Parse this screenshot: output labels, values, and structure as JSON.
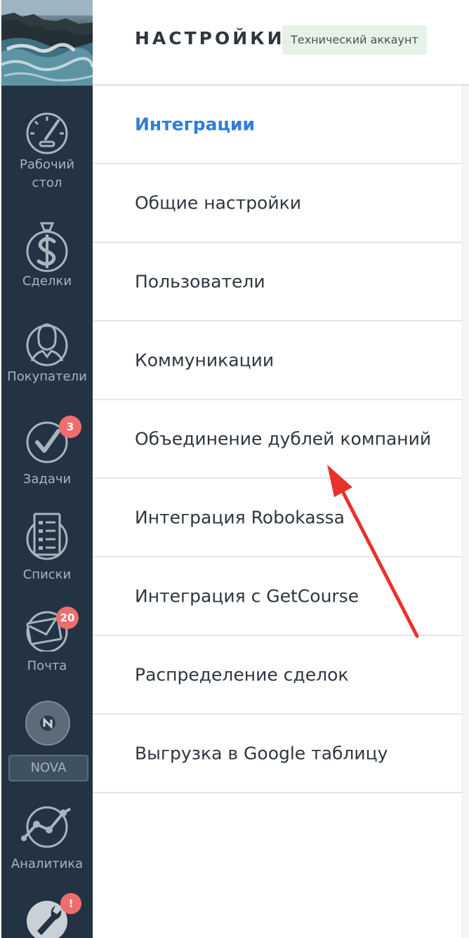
{
  "header": {
    "title": "НАСТРОЙКИ",
    "account_badge": "Технический аккаунт"
  },
  "nav": {
    "items": [
      {
        "label_line1": "Рабочий",
        "label_line2": "стол",
        "icon": "dashboard-gauge-icon"
      },
      {
        "label": "Сделки",
        "icon": "dollar-icon"
      },
      {
        "label": "Покупатели",
        "icon": "customer-icon"
      },
      {
        "label": "Задачи",
        "icon": "checkmark-icon",
        "badge": "3"
      },
      {
        "label": "Списки",
        "icon": "list-icon"
      },
      {
        "label": "Почта",
        "icon": "mail-icon",
        "badge": "20"
      },
      {
        "label": "NOVA",
        "icon": "nova-icon"
      },
      {
        "label": "Аналитика",
        "icon": "analytics-icon"
      },
      {
        "label": "",
        "icon": "settings-wrench-icon",
        "badge": "!"
      }
    ],
    "colors": {
      "background": "#233343",
      "text": "#a9b4bf",
      "badge": "#f06d6d"
    }
  },
  "settings_menu": {
    "active_color": "#2f7ed8",
    "items": [
      {
        "label": "Интеграции",
        "active": true
      },
      {
        "label": "Общие настройки"
      },
      {
        "label": "Пользователи"
      },
      {
        "label": "Коммуникации"
      },
      {
        "label": "Объединение дублей компаний"
      },
      {
        "label": "Интеграция Robokassa"
      },
      {
        "label": "Интеграция с GetCourse"
      },
      {
        "label": "Распределение сделок"
      },
      {
        "label": "Выгрузка в Google таблицу"
      }
    ]
  },
  "annotation": {
    "type": "arrow",
    "color": "#e8322b",
    "target": "Объединение дублей компаний"
  }
}
